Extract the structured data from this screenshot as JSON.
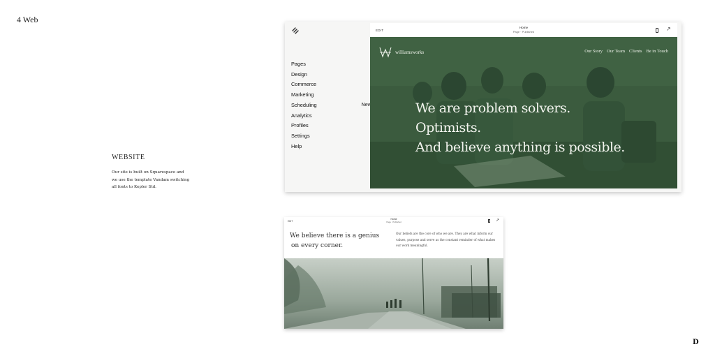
{
  "page_label": "4 Web",
  "section": {
    "heading": "WEBSITE",
    "description": "Our site is built on Squarespace and we use the template Vandam switching all fonts to Kepler Std."
  },
  "footer_mark": "D",
  "editor": {
    "logo_icon": "squarespace-logo-icon",
    "nav": [
      {
        "label": "Pages",
        "badge": ""
      },
      {
        "label": "Design",
        "badge": ""
      },
      {
        "label": "Commerce",
        "badge": ""
      },
      {
        "label": "Marketing",
        "badge": ""
      },
      {
        "label": "Scheduling",
        "badge": "New"
      },
      {
        "label": "Analytics",
        "badge": ""
      },
      {
        "label": "Profiles",
        "badge": ""
      },
      {
        "label": "Settings",
        "badge": ""
      },
      {
        "label": "Help",
        "badge": ""
      }
    ],
    "preview": {
      "edit_label": "EDIT",
      "page_title": "Home",
      "page_status": "Page · Published",
      "brand_name": "williamsworks",
      "site_nav": [
        "Our Story",
        "Our Team",
        "Clients",
        "Be in Touch"
      ],
      "headline": [
        "We are problem solvers.",
        "Optimists.",
        "And believe anything is possible."
      ],
      "hero_color": "#3b5a3e"
    }
  },
  "second_page": {
    "edit_label": "EDIT",
    "page_title": "Home",
    "page_status": "Page · Published",
    "genius_lines": [
      "We believe there is a genius",
      "on every corner."
    ],
    "beliefs_lines": [
      "Our beliefs are the core of who we are. They are what inform our",
      "values, purpose and serve as the constant reminder of what makes",
      "our work meaningful."
    ]
  }
}
